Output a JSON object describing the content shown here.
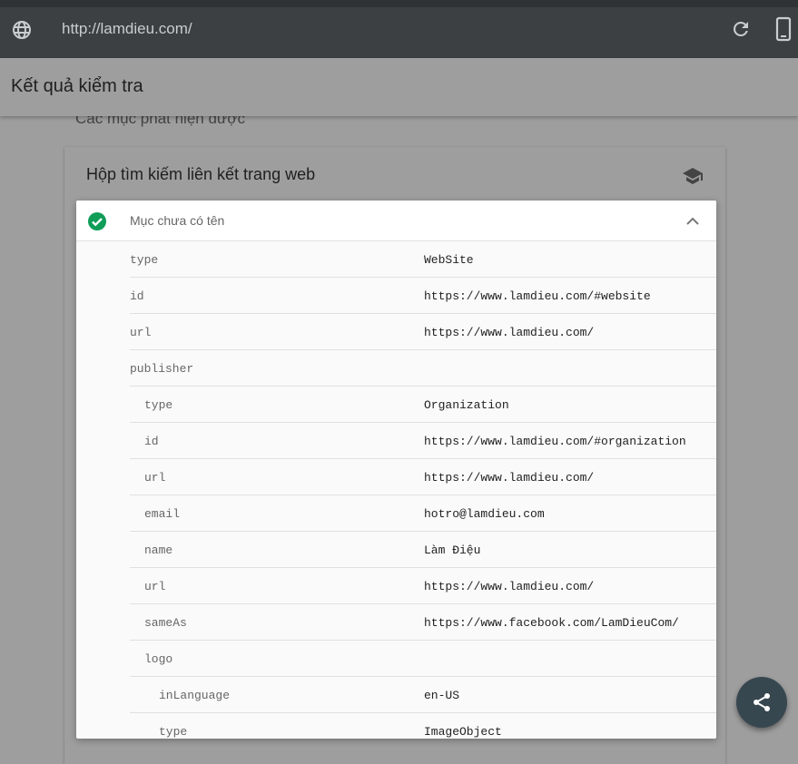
{
  "browser": {
    "url": "http://lamdieu.com/",
    "icons": [
      "globe-icon",
      "reload-icon",
      "mobile-device-icon"
    ]
  },
  "header": {
    "title": "Kết quả kiểm tra"
  },
  "section_label": "Các mục phát hiện được",
  "card": {
    "title": "Hộp tìm kiếm liên kết trang web",
    "icon": "graduation-cap-icon"
  },
  "item": {
    "title": "Mục chưa có tên",
    "status": "valid",
    "status_color": "#0f9d58"
  },
  "rows": [
    {
      "key": "type",
      "value": "WebSite",
      "level": 0
    },
    {
      "key": "id",
      "value": "https://www.lamdieu.com/#website",
      "level": 0
    },
    {
      "key": "url",
      "value": "https://www.lamdieu.com/",
      "level": 0
    },
    {
      "key": "publisher",
      "value": "",
      "level": 0
    },
    {
      "key": "type",
      "value": "Organization",
      "level": 1
    },
    {
      "key": "id",
      "value": "https://www.lamdieu.com/#organization",
      "level": 1
    },
    {
      "key": "url",
      "value": "https://www.lamdieu.com/",
      "level": 1
    },
    {
      "key": "email",
      "value": "hotro@lamdieu.com",
      "level": 1
    },
    {
      "key": "name",
      "value": "Làm Điệu",
      "level": 1
    },
    {
      "key": "url",
      "value": "https://www.lamdieu.com/",
      "level": 1
    },
    {
      "key": "sameAs",
      "value": "https://www.facebook.com/LamDieuCom/",
      "level": 1
    },
    {
      "key": "logo",
      "value": "",
      "level": 1
    },
    {
      "key": "inLanguage",
      "value": "en-US",
      "level": 2
    },
    {
      "key": "type",
      "value": "ImageObject",
      "level": 2
    }
  ],
  "fab": {
    "icon": "share-icon"
  }
}
